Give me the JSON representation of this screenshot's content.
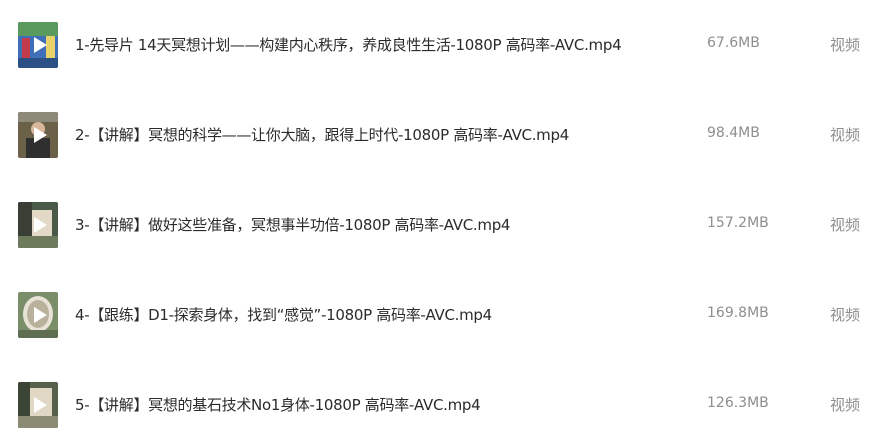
{
  "files": [
    {
      "name": "1-先导片 14天冥想计划——构建内心秩序，养成良性生活-1080P 高码率-AVC.mp4",
      "size": "67.6MB",
      "type": "视频",
      "thumb_colors": [
        "#3f6fb8",
        "#c33a4a",
        "#e8d36a",
        "#5a9a5e"
      ]
    },
    {
      "name": "2-【讲解】冥想的科学——让你大脑，跟得上时代-1080P 高码率-AVC.mp4",
      "size": "98.4MB",
      "type": "视频",
      "thumb_colors": [
        "#6b6048",
        "#d8b79c",
        "#2f2f2f",
        "#8e8a7a"
      ]
    },
    {
      "name": "3-【讲解】做好这些准备，冥想事半功倍-1080P 高码率-AVC.mp4",
      "size": "157.2MB",
      "type": "视频",
      "thumb_colors": [
        "#4a5a48",
        "#e2d9c6",
        "#6d7a5c",
        "#3a3f36"
      ]
    },
    {
      "name": "4-【跟练】D1-探索身体，找到“感觉”-1080P 高码率-AVC.mp4",
      "size": "169.8MB",
      "type": "视频",
      "thumb_colors": [
        "#7b8e6a",
        "#e8e3d6",
        "#5f6e50",
        "#b9b19c"
      ]
    },
    {
      "name": "5-【讲解】冥想的基石技术No1身体-1080P 高码率-AVC.mp4",
      "size": "126.3MB",
      "type": "视频",
      "thumb_colors": [
        "#56604a",
        "#e0d8c4",
        "#3c4436",
        "#8b8a72"
      ]
    }
  ]
}
